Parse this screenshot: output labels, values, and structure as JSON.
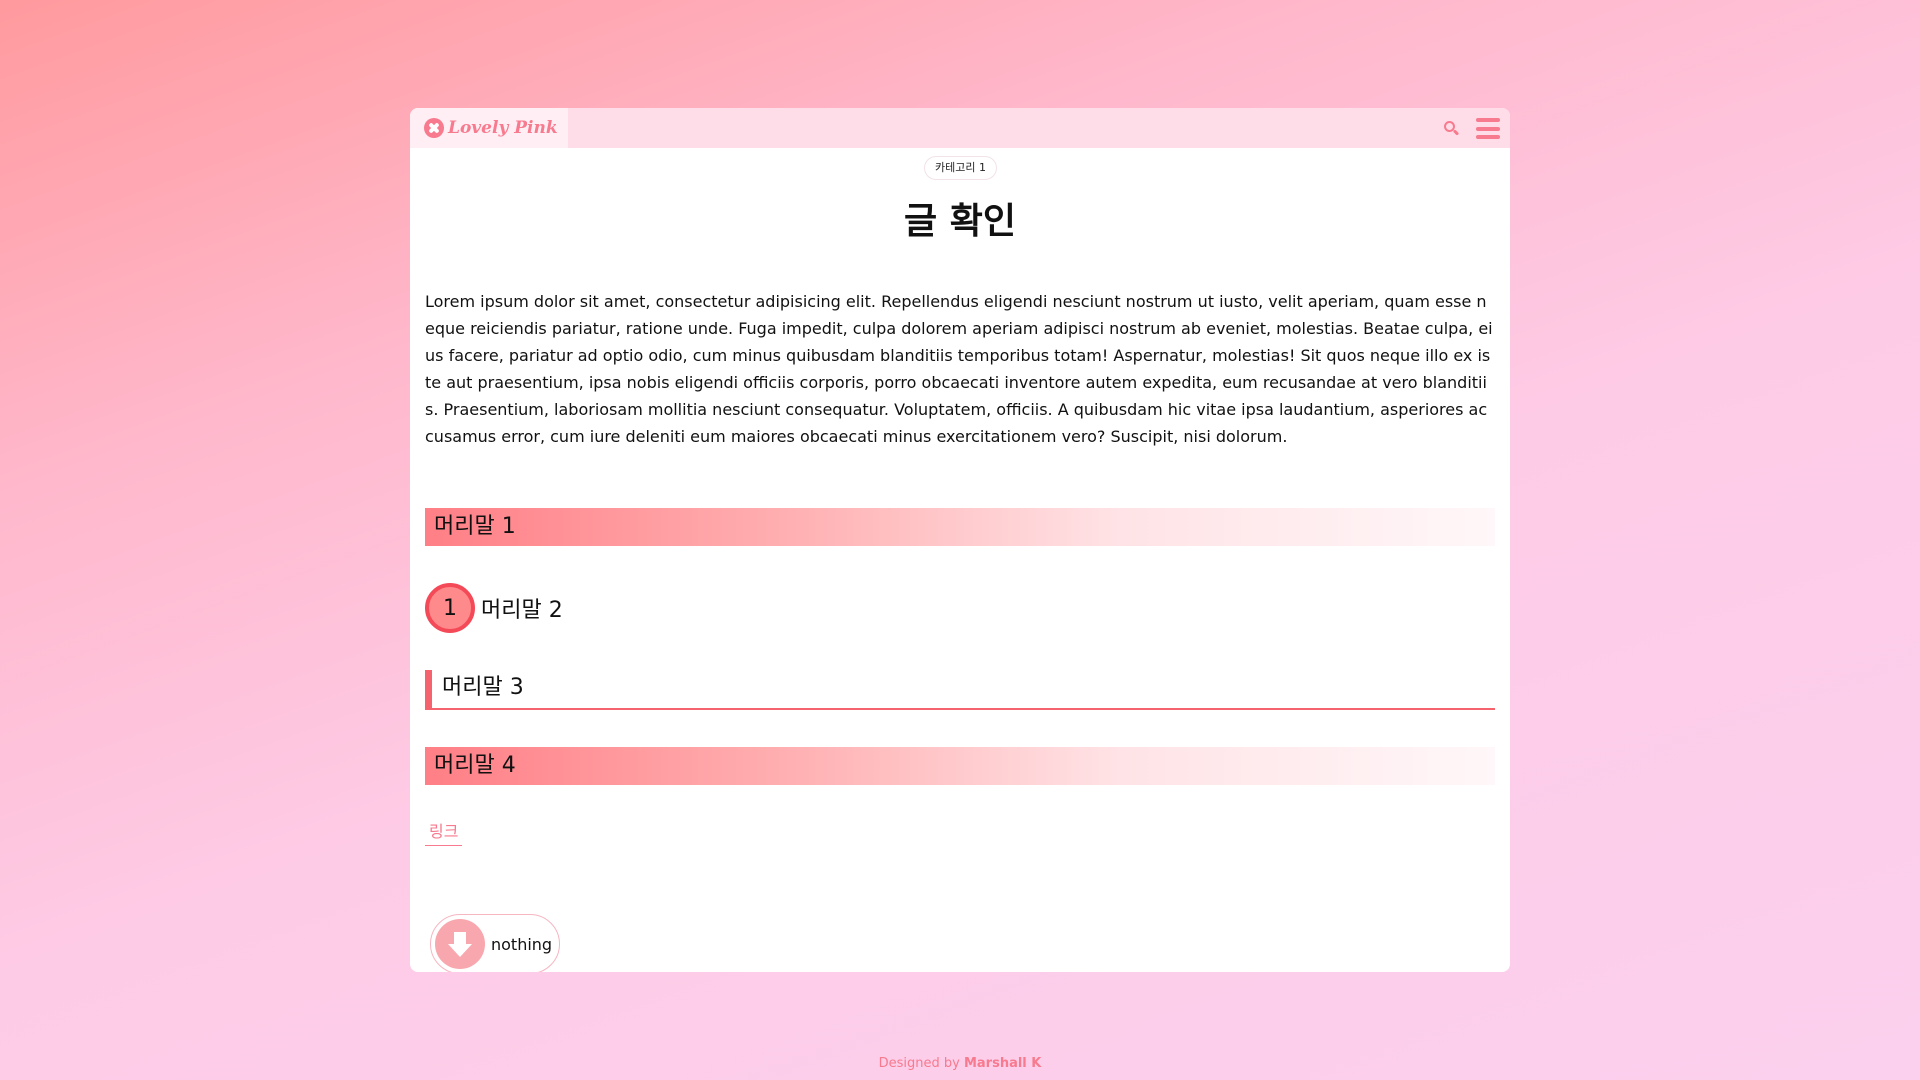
{
  "header": {
    "logo_text": "Lovely Pink",
    "logo_icon": "ribbon-x-icon",
    "search_icon": "search-icon",
    "menu_icon": "menu-icon"
  },
  "post": {
    "category": "카테고리 1",
    "title": "글 확인",
    "body": "Lorem ipsum dolor sit amet, consectetur adipisicing elit. Repellendus eligendi nesciunt nostrum ut iusto, velit aperiam, quam esse neque reiciendis pariatur, ratione unde. Fuga impedit, culpa dolorem aperiam adipisci nostrum ab eveniet, molestias. Beatae culpa, eius facere, pariatur ad optio odio, cum minus quibusdam blanditiis temporibus totam! Aspernatur, molestias! Sit quos neque illo ex iste aut praesentium, ipsa nobis eligendi officiis corporis, porro obcaecati inventore autem expedita, eum recusandae at vero blanditiis. Praesentium, laboriosam mollitia nesciunt consequatur. Voluptatem, officiis. A quibusdam hic vitae ipsa laudantium, asperiores accusamus error, cum iure deleniti eum maiores obcaecati minus exercitationem vero? Suscipit, nisi dolorum.",
    "heading1": "머리말 1",
    "heading2_number": "1",
    "heading2": "머리말 2",
    "heading3": "머리말 3",
    "heading4": "머리말 4",
    "link_text": "링크",
    "nothing_button": {
      "icon": "arrow-down-icon",
      "label": "nothing"
    }
  },
  "footer": {
    "prefix": "Designed by ",
    "author": "Marshall K"
  },
  "colors": {
    "accent": "#f77a8e",
    "accent_dark": "#f5636e",
    "topbar_bg": "#ffdde8"
  }
}
